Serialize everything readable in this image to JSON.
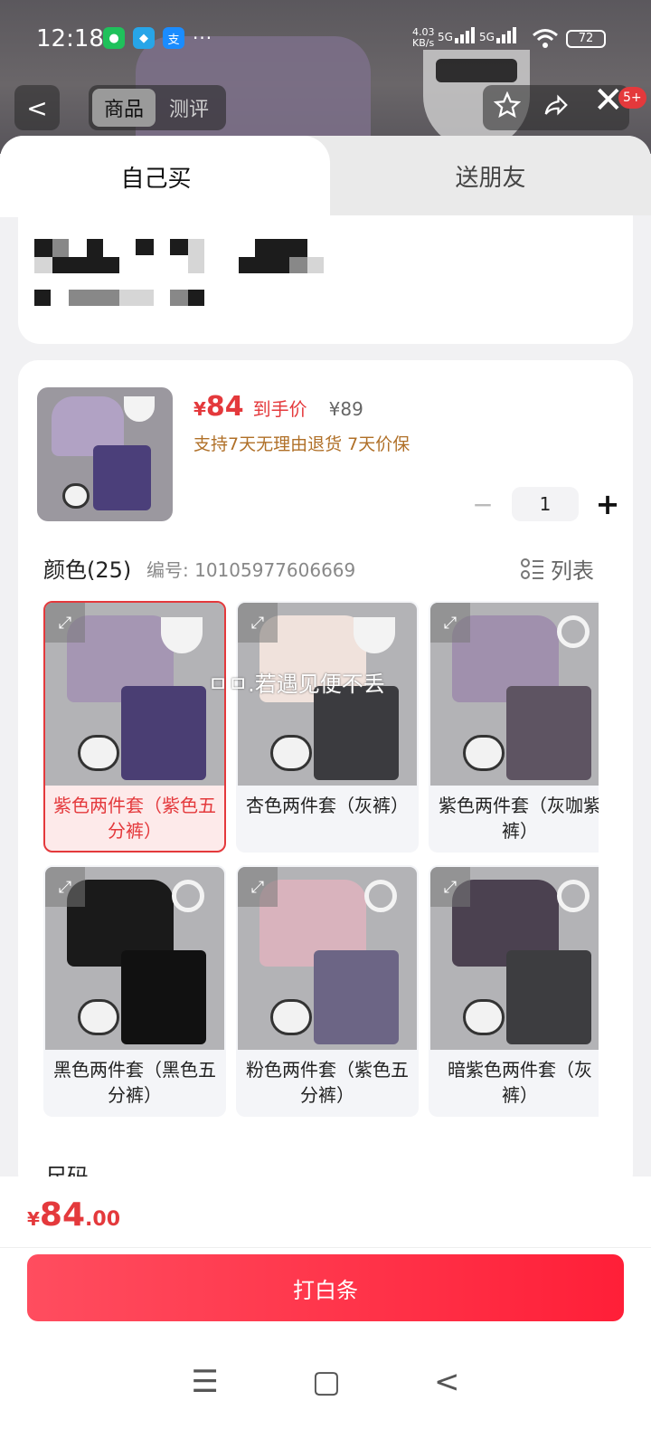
{
  "status_bar": {
    "time": "12:18",
    "more": "···",
    "speed": "4.03 KB/s",
    "net1": "5G",
    "net2": "5G",
    "sim": "6",
    "battery": "72"
  },
  "top_nav": {
    "back": "<",
    "tab_active": "商品",
    "tab_inactive": "测评",
    "msg_badge": "5+",
    "close": "✕"
  },
  "purchase_tabs": {
    "self": "自己买",
    "gift": "送朋友"
  },
  "product": {
    "price_symbol": "¥",
    "price": "84",
    "price_label": "到手价",
    "original_price": "¥89",
    "promo": "支持7天无理由退货 7天价保",
    "quantity": "1",
    "minus": "−",
    "plus": "+"
  },
  "color_section": {
    "title": "颜色(25)",
    "sku": "编号: 10105977606669",
    "list_label": "列表"
  },
  "overlay_text": "ㅁㅁ.若遇见便不丢",
  "variants": [
    {
      "caption": "紫色两件套（紫色五分裤）",
      "selected": true,
      "tee": "#a596b3",
      "pants": "#4a3e73",
      "acc": "visor"
    },
    {
      "caption": "杏色两件套（灰裤）",
      "selected": false,
      "tee": "#f0e2dc",
      "pants": "#3b3b3f",
      "acc": "visor"
    },
    {
      "caption": "紫色两件套（灰咖紫裤）",
      "selected": false,
      "tee": "#a090ad",
      "pants": "#5e5462",
      "acc": "headphones"
    },
    {
      "caption": "黑色两件套（黑色五分裤）",
      "selected": false,
      "tee": "#1a1a1a",
      "pants": "#111111",
      "acc": "headphones"
    },
    {
      "caption": "粉色两件套（紫色五分裤）",
      "selected": false,
      "tee": "#d9b3bd",
      "pants": "#6c6585",
      "acc": "headphones"
    },
    {
      "caption": "暗紫色两件套（灰裤）",
      "selected": false,
      "tee": "#4b4150",
      "pants": "#3d3d40",
      "acc": "headphones"
    }
  ],
  "size_section": {
    "title": "尺码"
  },
  "footer": {
    "symbol": "¥",
    "price_int": "84",
    "price_dec": ".00",
    "button": "打白条"
  },
  "system_nav": {
    "menu": "☰",
    "home": "▢",
    "back": "<"
  }
}
